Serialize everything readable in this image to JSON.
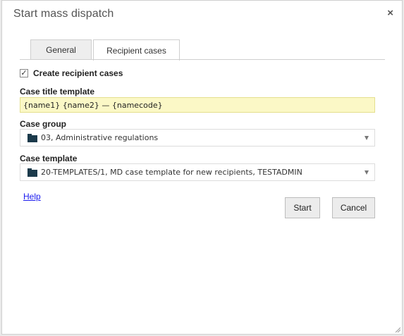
{
  "dialog": {
    "title": "Start mass dispatch",
    "close_glyph": "×"
  },
  "tabs": [
    {
      "label": "General",
      "active": false
    },
    {
      "label": "Recipient cases",
      "active": true
    }
  ],
  "create_cases": {
    "label": "Create recipient cases",
    "checked": true,
    "check_glyph": "✓"
  },
  "case_title": {
    "label": "Case title template",
    "value": "{name1} {name2} — {namecode}"
  },
  "case_group": {
    "label": "Case group",
    "value": "03, Administrative regulations",
    "icon": "folder-icon"
  },
  "case_template": {
    "label": "Case template",
    "value": "20-TEMPLATES/1, MD case template for new recipients, TESTADMIN",
    "icon": "folder-icon"
  },
  "help": {
    "label": "Help"
  },
  "buttons": {
    "start": "Start",
    "cancel": "Cancel"
  },
  "colors": {
    "input_highlight": "#fbf8c6",
    "folder": "#1b3a4b",
    "link": "#1a1aee"
  }
}
